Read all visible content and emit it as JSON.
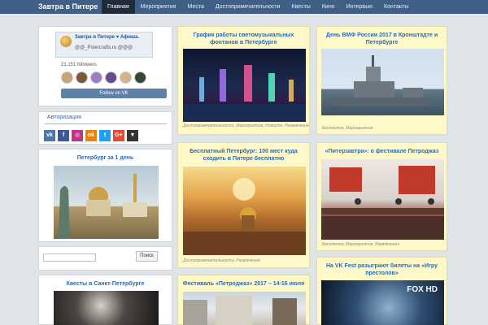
{
  "site": {
    "brand": "Завтра в Питере"
  },
  "nav": {
    "items": [
      {
        "label": "Главная",
        "active": true
      },
      {
        "label": "Мероприятия"
      },
      {
        "label": "Места"
      },
      {
        "label": "Достопримечательности"
      },
      {
        "label": "Квесты"
      },
      {
        "label": "Кино"
      },
      {
        "label": "Интервью"
      },
      {
        "label": "Контакты"
      }
    ]
  },
  "sidebar": {
    "vk_widget": {
      "group_title": "Завтра в Питере ♥ Афиша.",
      "group_sub": "@@_Pstercrafts.ru @@@",
      "followers": "21,151 followers",
      "follow_label": "Follow on VK"
    },
    "auth": {
      "title": "Авторизация",
      "socials": [
        {
          "icon": "vk-icon",
          "glyph": "vk",
          "color": "#4a76a8"
        },
        {
          "icon": "facebook-icon",
          "glyph": "f",
          "color": "#3b5998"
        },
        {
          "icon": "instagram-icon",
          "glyph": "◎",
          "color": "#c13584"
        },
        {
          "icon": "odnoklassniki-icon",
          "glyph": "ok",
          "color": "#ee8208"
        },
        {
          "icon": "twitter-icon",
          "glyph": "t",
          "color": "#1da1f2"
        },
        {
          "icon": "google-plus-icon",
          "glyph": "G+",
          "color": "#dd4b39"
        },
        {
          "icon": "dropdown-icon",
          "glyph": "▼",
          "color": "#333333"
        }
      ]
    },
    "spb_day": {
      "title": "Петербург за 1 день"
    },
    "search": {
      "placeholder": "",
      "button_label": "Поиск"
    },
    "quests": {
      "title": "Квесты в Санкт-Петербурге"
    }
  },
  "posts": [
    {
      "title": "График работы светомузыкальных фонтанов в Петербурге",
      "cats": "Достопримечательности, Мероприятия, Новости, Развлечения"
    },
    {
      "title": "День ВМФ России 2017 в Кронштадте и Петербурге",
      "cats": "Бесплатно, Мероприятия"
    },
    {
      "title": "Бесплатный Петербург: 100 мест куда сходить в Питере бесплатно",
      "cats": "Достопримечательности, Развлечения"
    },
    {
      "title": "«Питерзавтра»: о фестивале Петроджаз",
      "cats": "Бесплатно, Мероприятия, Развлечения"
    },
    {
      "title": "Фестиваль «Петроджаз» 2017 – 14-16 июля",
      "cats": ""
    },
    {
      "title": "На VK Fest разыграют билеты на «Игру престолов»",
      "cats": "",
      "badge": "FOX HD"
    }
  ],
  "colors": {
    "nav_bg": "#3f5f86",
    "nav_active": "#1e2b3a",
    "post_bg": "#fff9c9",
    "link": "#2a6bb0"
  }
}
